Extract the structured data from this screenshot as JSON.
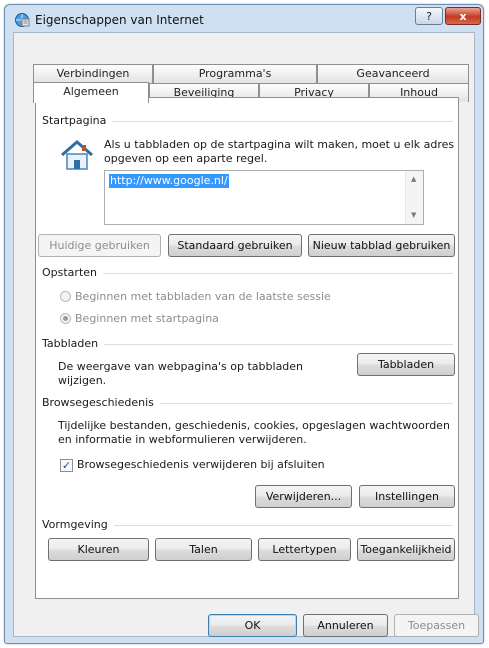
{
  "window": {
    "title": "Eigenschappen van Internet",
    "icon": "internet-options-icon",
    "help_label": "?",
    "close_label": "x"
  },
  "tabs_row_back": [
    "Verbindingen",
    "Programma's",
    "Geavanceerd"
  ],
  "tabs_row_front": [
    "Algemeen",
    "Beveiliging",
    "Privacy",
    "Inhoud"
  ],
  "active_tab": "Algemeen",
  "startpagina": {
    "label": "Startpagina",
    "description": "Als u tabbladen op de startpagina wilt maken, moet u elk adres opgeven op een aparte regel.",
    "icon": "house-icon",
    "url": "http://www.google.nl/",
    "buttons": {
      "huidige": "Huidige gebruiken",
      "standaard": "Standaard gebruiken",
      "nieuw": "Nieuw tabblad gebruiken"
    }
  },
  "opstarten": {
    "label": "Opstarten",
    "option1": "Beginnen met tabbladen van de laatste sessie",
    "option2": "Beginnen met startpagina",
    "selected": "Beginnen met startpagina"
  },
  "tabbladen": {
    "label": "Tabbladen",
    "description": "De weergave van webpagina's op tabbladen wijzigen.",
    "button": "Tabbladen"
  },
  "browsegeschiedenis": {
    "label": "Browsegeschiedenis",
    "description": "Tijdelijke bestanden, geschiedenis, cookies, opgeslagen wachtwoorden en informatie in webformulieren verwijderen.",
    "checkbox_label": "Browsegeschiedenis verwijderen bij afsluiten",
    "checkbox_checked": true,
    "btn_verwijderen": "Verwijderen...",
    "btn_instellingen": "Instellingen"
  },
  "vormgeving": {
    "label": "Vormgeving",
    "buttons": {
      "kleuren": "Kleuren",
      "talen": "Talen",
      "lettertypen": "Lettertypen",
      "toegankelijkheid": "Toegankelijkheid"
    }
  },
  "footer": {
    "ok": "OK",
    "annuleren": "Annuleren",
    "toepassen": "Toepassen"
  }
}
